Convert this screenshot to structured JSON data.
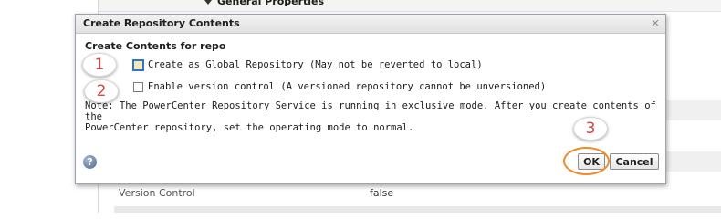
{
  "background": {
    "section_title": "General Properties",
    "rows": [
      {
        "label": "",
        "value": ""
      },
      {
        "label": "",
        "value": ""
      },
      {
        "label": "Version Control",
        "value": "false"
      }
    ]
  },
  "dialog": {
    "title": "Create Repository Contents",
    "close_glyph": "×",
    "section_heading": "Create Contents for repo",
    "options": [
      {
        "label": "Create as Global Repository (May not be reverted to local)",
        "checked": false,
        "focused": true
      },
      {
        "label": "Enable version control (A versioned repository cannot be unversioned)",
        "checked": false,
        "focused": false
      }
    ],
    "note_line1": "Note: The PowerCenter Repository Service is running in exclusive mode. After you create contents of the",
    "note_line2": "PowerCenter repository, set the operating mode to normal.",
    "help_glyph": "?",
    "help_icon": "help-icon",
    "ok_label": "OK",
    "cancel_label": "Cancel"
  },
  "annotations": {
    "callout_1": "1",
    "callout_2": "2",
    "callout_3": "3",
    "highlight_color": "#f08a24",
    "callout_color": "#d64541"
  },
  "colors": {
    "focus_border": "#2f76c9",
    "titlebar": "#e1e1e1"
  }
}
